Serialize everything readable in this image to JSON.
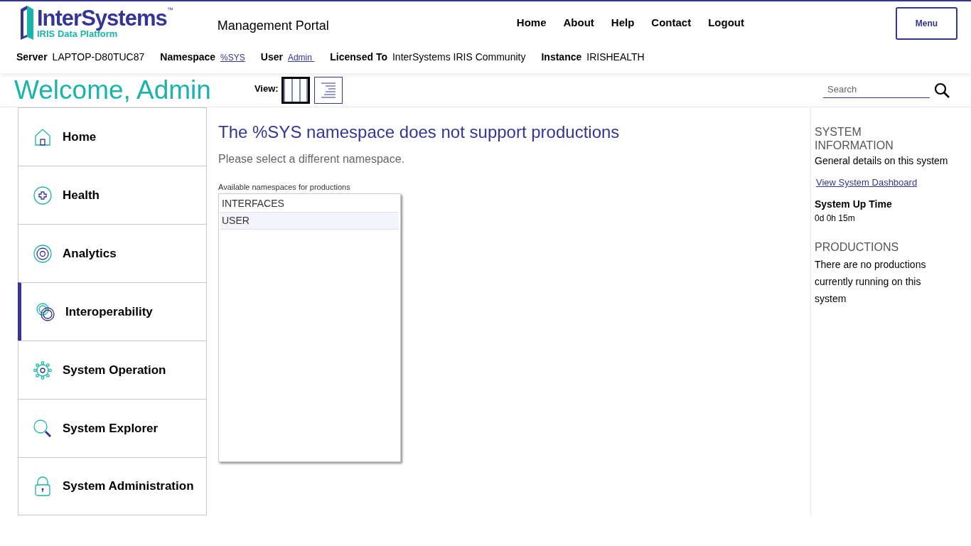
{
  "header": {
    "logo": {
      "name": "InterSystems",
      "trademark": "™",
      "subtitle": "IRIS Data Platform"
    },
    "title": "Management Portal",
    "nav": [
      "Home",
      "About",
      "Help",
      "Contact",
      "Logout"
    ],
    "menu_button": "Menu",
    "info": [
      {
        "label": "Server",
        "value": "LAPTOP-D80TUC87",
        "kind": "text"
      },
      {
        "label": "Namespace",
        "value": "%SYS",
        "kind": "link"
      },
      {
        "label": "User",
        "value": "Admin ",
        "kind": "link"
      },
      {
        "label": "Licensed To",
        "value": "InterSystems IRIS Community",
        "kind": "text"
      },
      {
        "label": "Instance",
        "value": "IRISHEALTH",
        "kind": "text"
      }
    ]
  },
  "welcome": "Welcome, Admin",
  "view": {
    "label": "View:",
    "options": [
      {
        "kind": "columns",
        "selected": true
      },
      {
        "kind": "list",
        "selected": false
      }
    ]
  },
  "search": {
    "placeholder": "Search"
  },
  "sidebar": {
    "items": [
      {
        "label": "Home",
        "selected": false
      },
      {
        "label": "Health",
        "selected": false
      },
      {
        "label": "Analytics",
        "selected": false
      },
      {
        "label": "Interoperability",
        "selected": true
      },
      {
        "label": "System Operation",
        "selected": false
      },
      {
        "label": "System Explorer",
        "selected": false
      },
      {
        "label": "System Administration",
        "selected": false
      }
    ]
  },
  "main": {
    "heading": "The %SYS namespace does not support productions",
    "subheading": "Please select a different namespace.",
    "list_label": "Available namespaces for productions",
    "namespaces": [
      "INTERFACES",
      "USER"
    ]
  },
  "info_panel": {
    "title": "SYSTEM INFORMATION",
    "description": "General details on this system",
    "link": "View System Dashboard",
    "uptime_label": "System Up Time",
    "uptime": "0d 0h 15m",
    "productions_title": "PRODUCTIONS",
    "productions_text": "There are no productions currently running on this system"
  }
}
